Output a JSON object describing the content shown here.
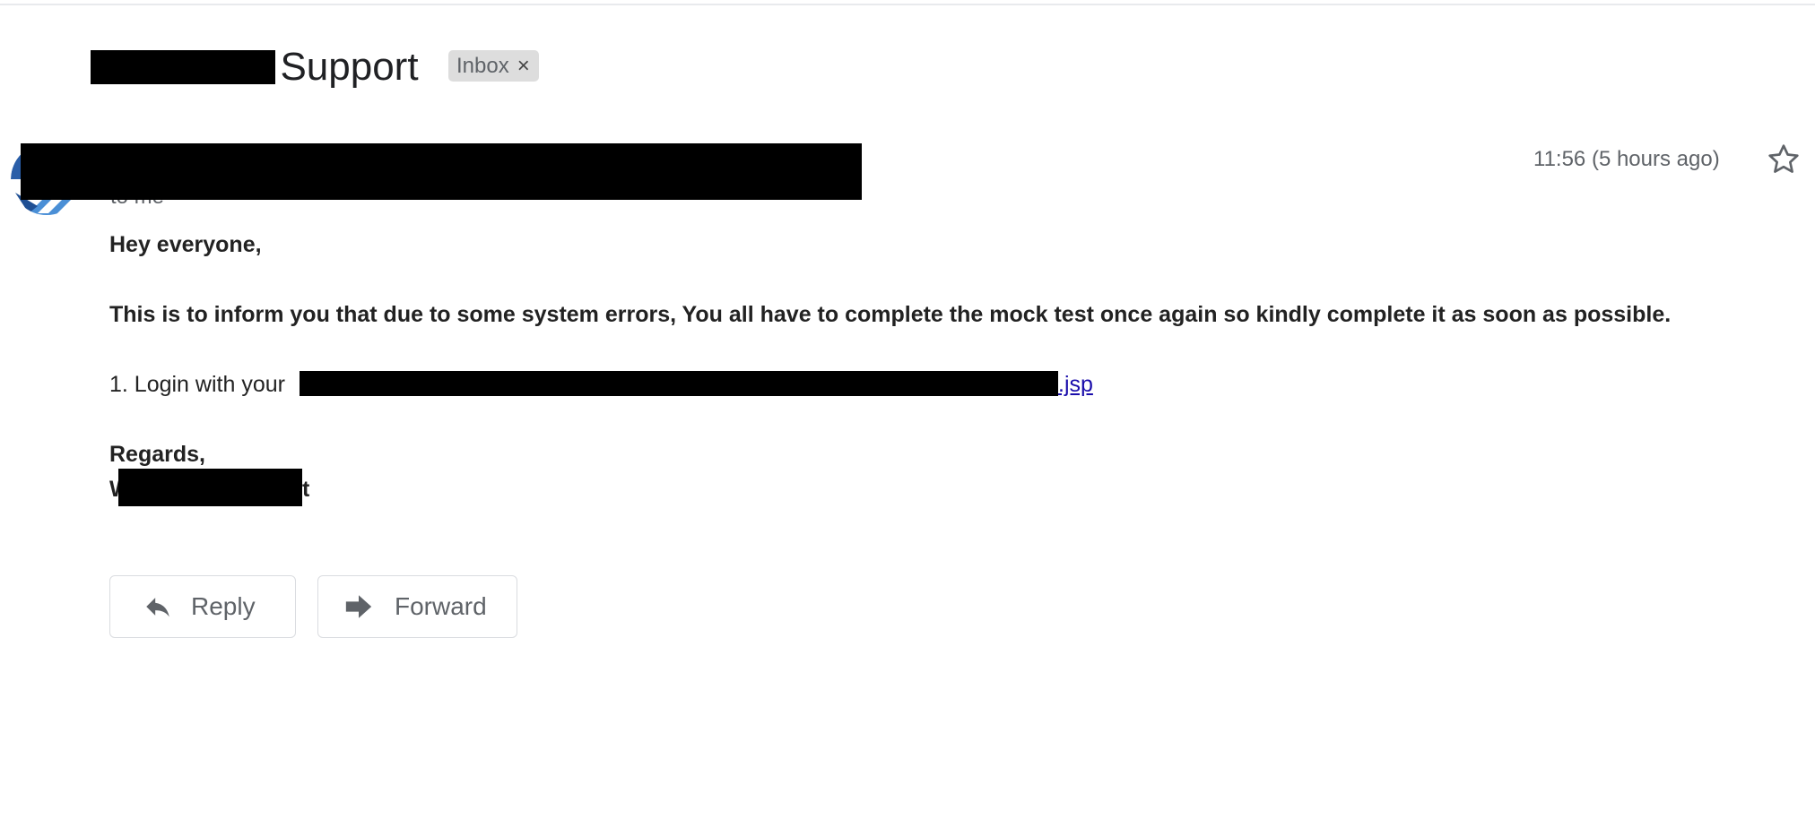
{
  "header": {
    "subject_visible_tail": "t Support",
    "label_chip": "Inbox",
    "label_chip_close": "×"
  },
  "message": {
    "recipient_line": "to me",
    "timestamp": "11:56 (5 hours ago)",
    "body": {
      "greeting": "Hey everyone,",
      "paragraph": "This is to inform you that due to some system errors, You all have to complete the mock test once again so kindly complete it as soon as possible.",
      "login_prefix": "1. Login with your ",
      "link_tail": ".jsp",
      "regards": "Regards,",
      "signature_lead": "W",
      "signature_tail": "t"
    }
  },
  "actions": {
    "reply_label": "Reply",
    "forward_label": "Forward"
  },
  "icons": {
    "star": "star-outline-icon",
    "reply": "reply-arrow-icon",
    "forward": "forward-arrow-icon",
    "avatar": "sender-avatar"
  },
  "colors": {
    "link": "#1a0dab",
    "muted_text": "#5f6368",
    "chip_bg": "#dddddd",
    "redaction": "#000000"
  }
}
